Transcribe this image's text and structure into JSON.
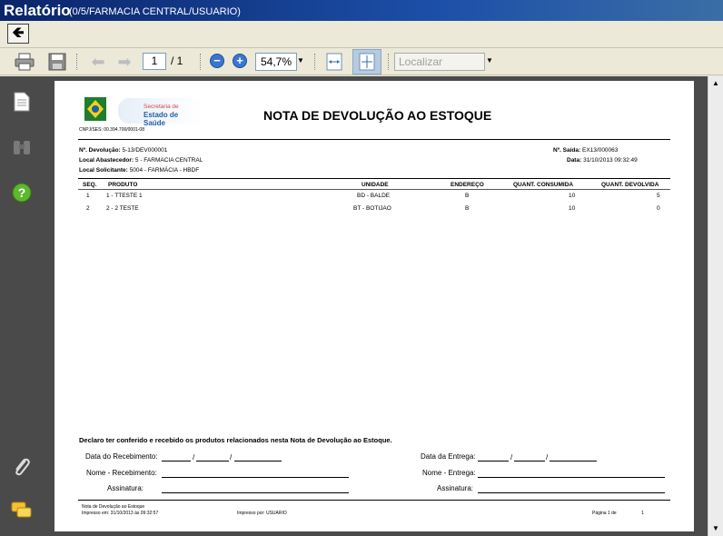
{
  "window": {
    "title": "Relatório",
    "subtitle": "(0/5/FARMACIA CENTRAL/USUARIO)"
  },
  "toolbar": {
    "back_icon": "arrow-left-icon",
    "page_current": "1",
    "page_total": "/ 1",
    "zoom": "54,7%",
    "search_placeholder": "Localizar"
  },
  "report": {
    "cnpj": "CNPJ/SES: 00.394.700/0001-08",
    "logo_text_1": "Secretaria de",
    "logo_text_2": "Estado de Saúde",
    "title": "NOTA DE DEVOLUÇÃO AO ESTOQUE",
    "devolucao_label": "Nº. Devolução:",
    "devolucao_value": "5-13/DEV000001",
    "abastecedor_label": "Local Abastecedor:",
    "abastecedor_value": "5 - FARMACIA CENTRAL",
    "solicitante_label": "Local Solicitante:",
    "solicitante_value": "5004 - FARMÁCIA - HBDF",
    "saida_label": "Nº. Saída:",
    "saida_value": "EX13/000063",
    "data_label": "Data:",
    "data_value": "31/10/2013 09:32:49",
    "columns": [
      "SEQ.",
      "PRODUTO",
      "UNIDADE",
      "ENDEREÇO",
      "QUANT. CONSUMIDA",
      "QUANT. DEVOLVIDA"
    ],
    "rows": [
      {
        "seq": "1",
        "produto": "1 - TTESTE 1",
        "unidade": "BD - BALDE",
        "endereco": "B",
        "consumida": "10",
        "devolvida": "5"
      },
      {
        "seq": "2",
        "produto": "2 - 2 TESTE",
        "unidade": "BT - BOTIJAO",
        "endereco": "B",
        "consumida": "10",
        "devolvida": "0"
      }
    ],
    "declaration": "Declaro ter conferido e recebido os produtos relacionados nesta Nota de Devolução ao Estoque.",
    "data_recebimento": "Data do Recebimento:",
    "nome_recebimento": "Nome - Recebimento:",
    "assinatura_1": "Assinatura:",
    "data_entrega": "Data da Entrega:",
    "nome_entrega": "Nome - Entrega:",
    "assinatura_2": "Assinatura:",
    "footer_doc": "Nota de Devolução ao Estoque",
    "footer_impresso": "Impresso em: 31/10/2013 às 09:32:57",
    "footer_por": "Impresso por: USUARIO",
    "footer_pagina": "Página 1 de",
    "footer_total": "1"
  }
}
